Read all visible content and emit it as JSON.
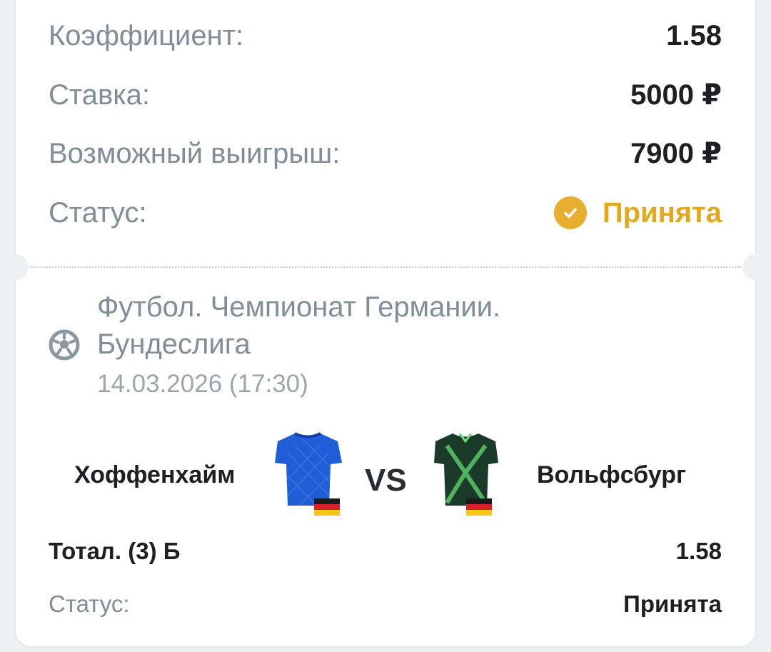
{
  "summary": {
    "coefficient_label": "Коэффициент:",
    "coefficient_value": "1.58",
    "stake_label": "Ставка:",
    "stake_value": "5000 ₽",
    "possible_win_label": "Возможный выигрыш:",
    "possible_win_value": "7900 ₽",
    "status_label": "Статус:",
    "status_value": "Принята"
  },
  "event": {
    "league_line1": "Футбол. Чемпионат Германии.",
    "league_line2": "Бундеслига",
    "datetime": "14.03.2026 (17:30)",
    "home_team": "Хоффенхайм",
    "vs": "VS",
    "away_team": "Вольфсбург",
    "market": "Тотал. (3) Б",
    "market_odds": "1.58",
    "status_label": "Статус:",
    "status_value": "Принята"
  },
  "colors": {
    "accent": "#e4a81f",
    "label": "#7f8e97",
    "home_jersey": "#1f5ed6",
    "away_jersey": "#1c3a2a"
  },
  "icons": {
    "status": "check-circle-icon",
    "sport": "soccer-ball-icon",
    "flag": "germany-flag-icon"
  }
}
